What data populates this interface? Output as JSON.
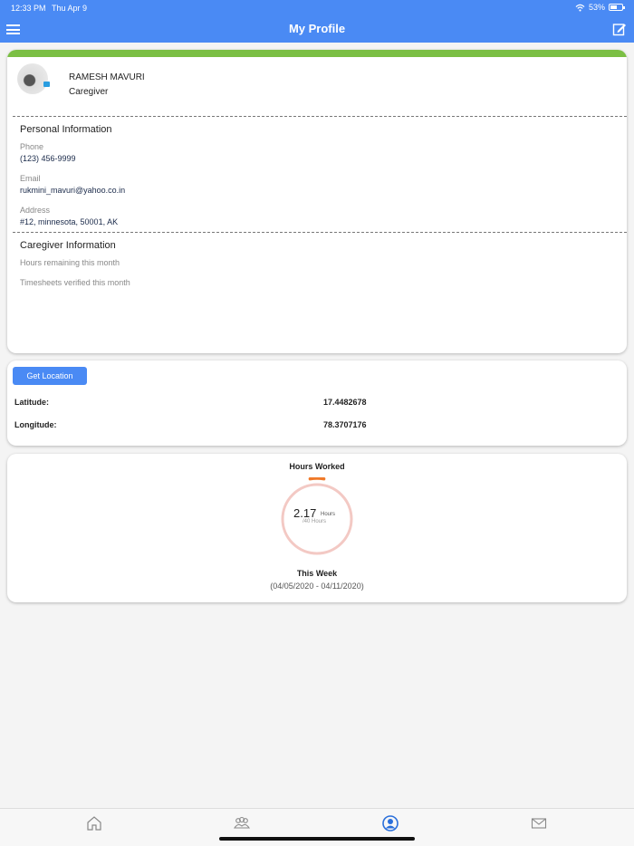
{
  "status_bar": {
    "time": "12:33 PM",
    "date": "Thu Apr 9",
    "battery": "53%"
  },
  "header": {
    "title": "My Profile"
  },
  "profile": {
    "name": "RAMESH MAVURI",
    "role": "Caregiver",
    "personal_title": "Personal Information",
    "phone_label": "Phone",
    "phone": "(123) 456-9999",
    "email_label": "Email",
    "email": "rukmini_mavuri@yahoo.co.in",
    "address_label": "Address",
    "address": "#12, minnesota, 50001, AK",
    "caregiver_title": "Caregiver Information",
    "hours_remaining_label": "Hours remaining this month",
    "timesheets_label": "Timesheets verified this month"
  },
  "location": {
    "button_label": "Get Location",
    "latitude_label": "Latitude:",
    "latitude": "17.4482678",
    "longitude_label": "Longitude:",
    "longitude": "78.3707176"
  },
  "hours": {
    "title": "Hours Worked",
    "value": "2.17",
    "unit": "Hours",
    "total": "/40 Hours",
    "progress": 0.054,
    "period_title": "This Week",
    "period_range": "(04/05/2020 - 04/11/2020)",
    "track_color": "#f3c9c4",
    "progress_color": "#f07a2a"
  },
  "tabs": [
    "home-icon",
    "group-icon",
    "profile-icon",
    "mail-icon"
  ],
  "colors": {
    "primary": "#4a8af4",
    "accent_bar": "#7bbf44",
    "active_tab": "#2a6fdb"
  }
}
